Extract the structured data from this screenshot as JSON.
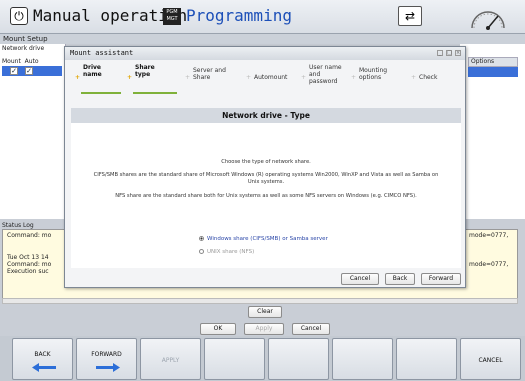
{
  "topbar": {
    "mode_title": "Manual operation",
    "program_icon_text": "PGM MGT",
    "program_title": "Programming",
    "toggle_icon": "screen-toggle-icon",
    "gauge_icon": "gauge-icon",
    "title_color": "#1c4fb8"
  },
  "window": {
    "title": "Mount Setup",
    "network_drive_label": "Network drive",
    "col_mount": "Mount",
    "col_auto": "Auto",
    "col_options": "Options",
    "status_label": "Status Log",
    "status_lines": [
      "Command: mo",
      "Tue Oct 13 14",
      "Command: mo",
      "Execution suc"
    ],
    "status_right_lines": [
      "mode=0777,",
      "mode=0777,"
    ],
    "clear_button": "Clear",
    "ok_button": "OK",
    "apply_button": "Apply",
    "cancel_button": "Cancel"
  },
  "dialog": {
    "title": "Mount assistant",
    "steps": [
      {
        "label": "Drive name",
        "active": true
      },
      {
        "label": "Share type",
        "active": true
      },
      {
        "label": "Server and Share",
        "active": false
      },
      {
        "label": "Automount",
        "active": false
      },
      {
        "label": "User name and password",
        "active": false
      },
      {
        "label": "Mounting options",
        "active": false
      },
      {
        "label": "Check",
        "active": false
      }
    ],
    "content_title": "Network drive - Type",
    "para1": "Choose the type of network share.",
    "para2": "CIFS/SMB shares are the standard share of Microsoft Windows (R) operating systems Win2000, WinXP and Vista as well as Samba on Unix systems.",
    "para3": "NFS share are the standard share both for Unix systems as well as some NFS servers on Windows (e.g. CIMCO NFS).",
    "option_cifs": "Windows share (CIFS/SMB) or Samba server",
    "option_nfs": "UNIX share (NFS)",
    "selected_option": "Windows share (CIFS/SMB) or Samba server",
    "btn_cancel": "Cancel",
    "btn_back": "Back",
    "btn_forward": "Forward",
    "accent_color": "#7fb13a"
  },
  "softkeys": {
    "back": "BACK",
    "forward": "FORWARD",
    "apply": "APPLY",
    "cancel": "CANCEL",
    "arrow_color": "#2c6ed8"
  }
}
